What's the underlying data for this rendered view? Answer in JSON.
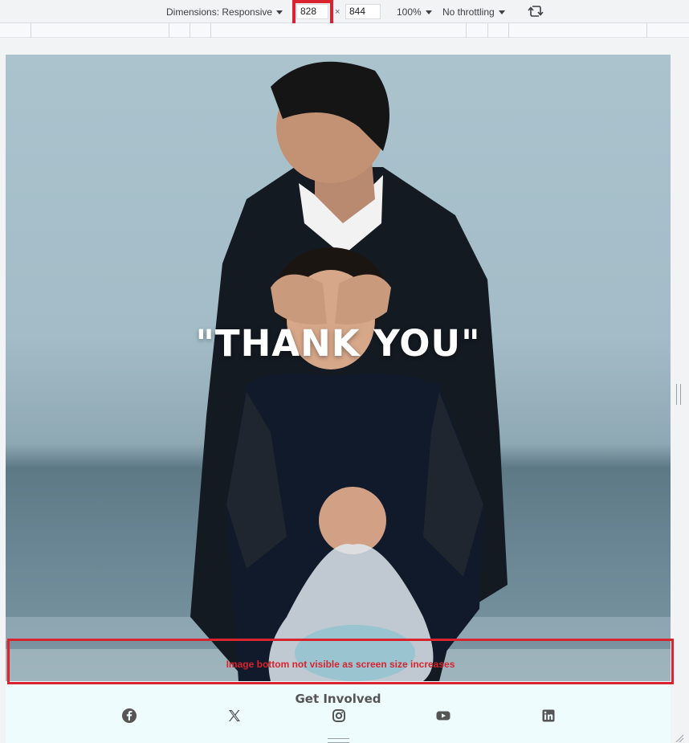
{
  "devtools": {
    "dimensions_label": "Dimensions: Responsive",
    "width_value": "828",
    "height_value": "844",
    "times_sign": "×",
    "zoom_label": "100%",
    "throttling_label": "No throttling",
    "rotate_icon": "rotate-icon"
  },
  "hero": {
    "title": "\"THANK YOU\""
  },
  "annotation": {
    "text": "Image bottom not visible as screen size increases",
    "color": "#d9232e"
  },
  "footer": {
    "title": "Get Involved",
    "social_icons": [
      "facebook-icon",
      "x-icon",
      "instagram-icon",
      "youtube-icon",
      "linkedin-icon"
    ]
  },
  "colors": {
    "accent_red": "#d9232e",
    "footer_bg": "#eefcfd",
    "icon_color": "#555555"
  }
}
